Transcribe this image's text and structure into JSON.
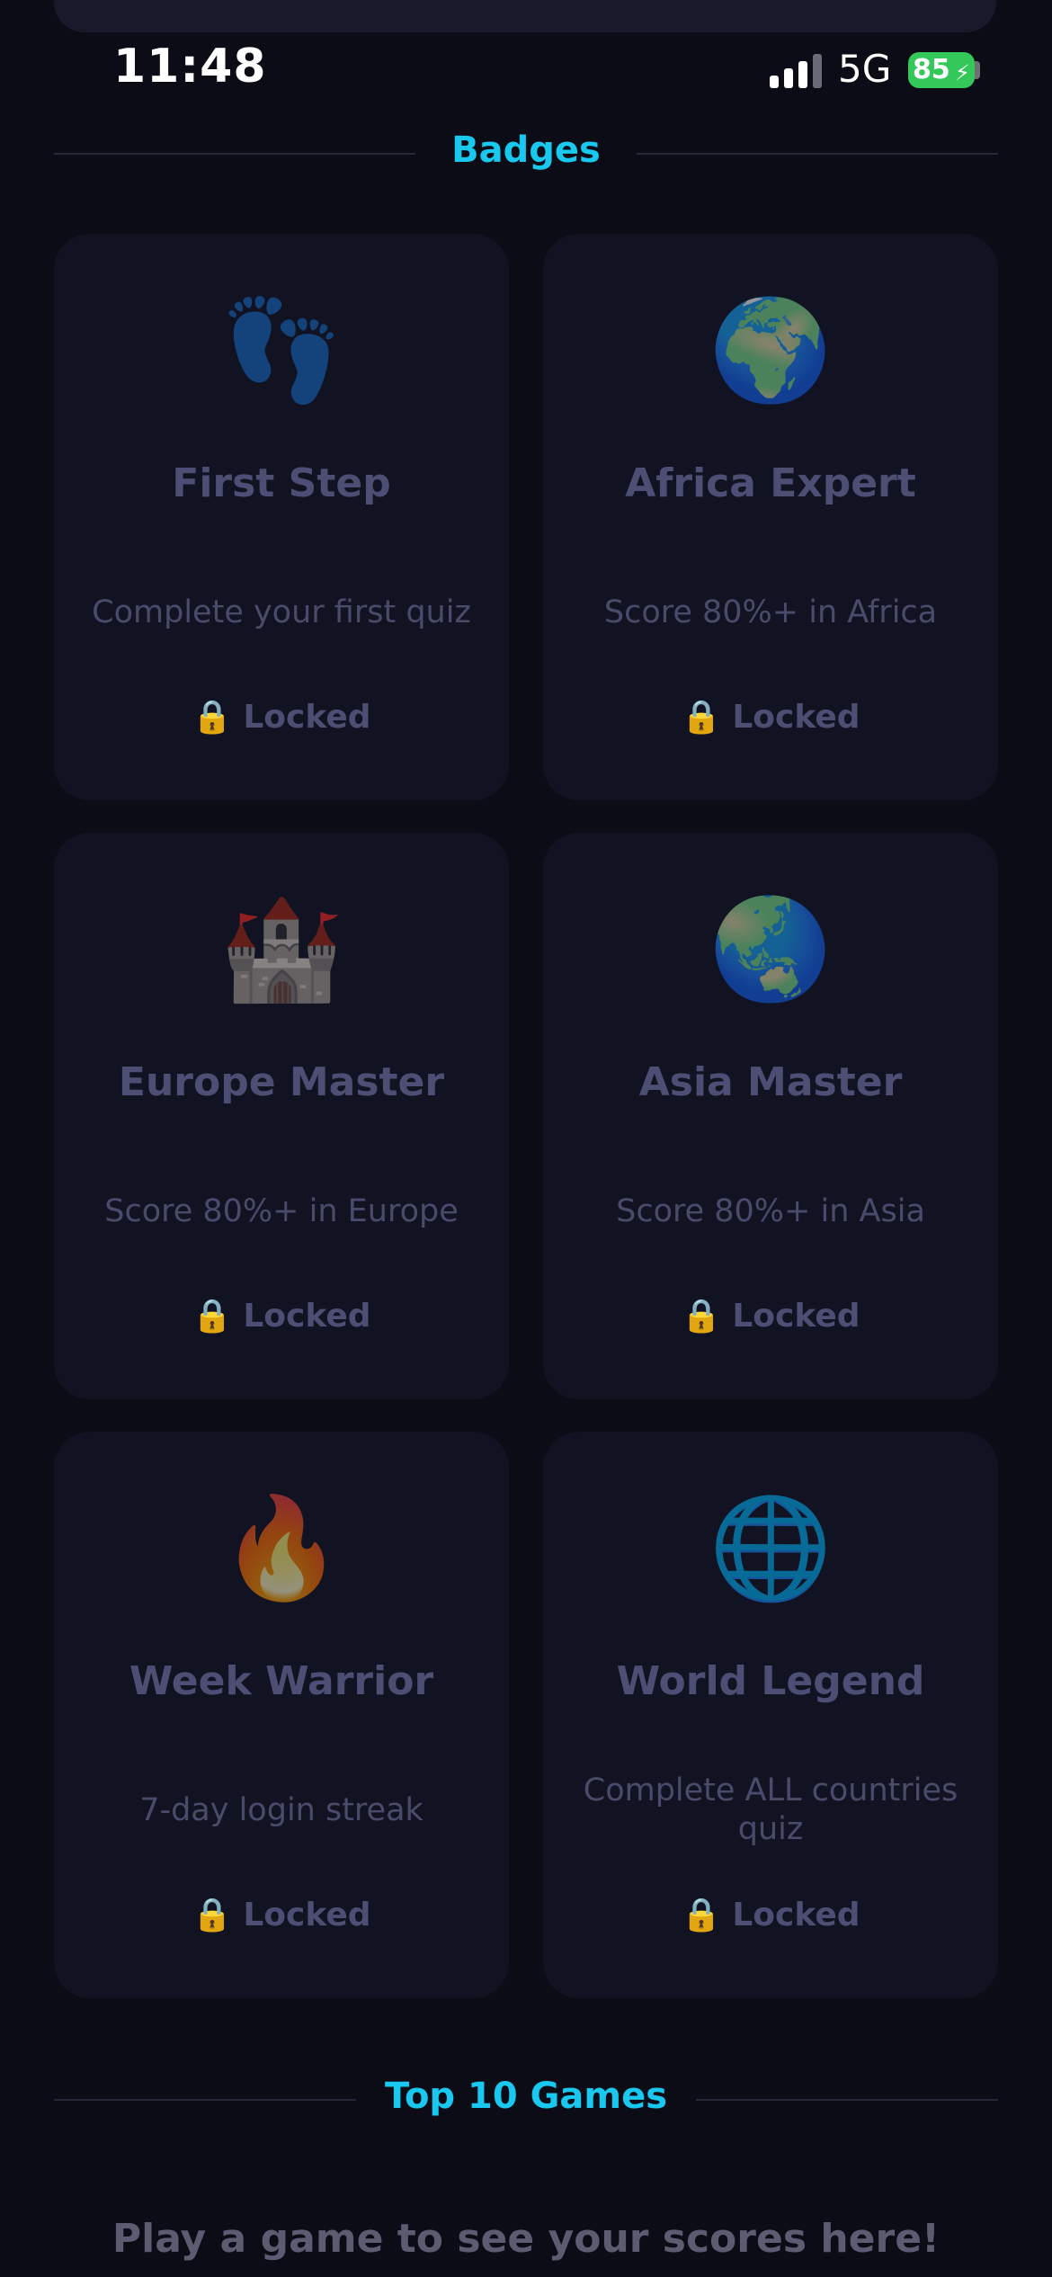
{
  "status_bar": {
    "time": "11:48",
    "network": "5G",
    "battery": "85"
  },
  "badges_section": {
    "title": "Badges",
    "items": [
      {
        "icon": "👣",
        "icon_name": "footprints-icon",
        "title": "First Step",
        "description": "Complete your first quiz",
        "status": "Locked"
      },
      {
        "icon": "🌍",
        "icon_name": "globe-africa-icon",
        "title": "Africa Expert",
        "description": "Score 80%+ in Africa",
        "status": "Locked"
      },
      {
        "icon": "🏰",
        "icon_name": "castle-icon",
        "title": "Europe Master",
        "description": "Score 80%+ in Europe",
        "status": "Locked"
      },
      {
        "icon": "🌏",
        "icon_name": "globe-asia-icon",
        "title": "Asia Master",
        "description": "Score 80%+ in Asia",
        "status": "Locked"
      },
      {
        "icon": "🔥",
        "icon_name": "fire-icon",
        "title": "Week Warrior",
        "description": "7-day login streak",
        "status": "Locked"
      },
      {
        "icon": "🌐",
        "icon_name": "globe-meridians-icon",
        "title": "World Legend",
        "description": "Complete ALL countries quiz",
        "status": "Locked"
      }
    ],
    "lock_icon": "🔒"
  },
  "top_games_section": {
    "title": "Top 10 Games",
    "empty_message": "Play a game to see your scores here!"
  },
  "colors": {
    "background": "#0b0c16",
    "card": "#121322",
    "accent": "#19c8ee",
    "muted_text": "#4d4e73",
    "battery": "#34c759"
  }
}
